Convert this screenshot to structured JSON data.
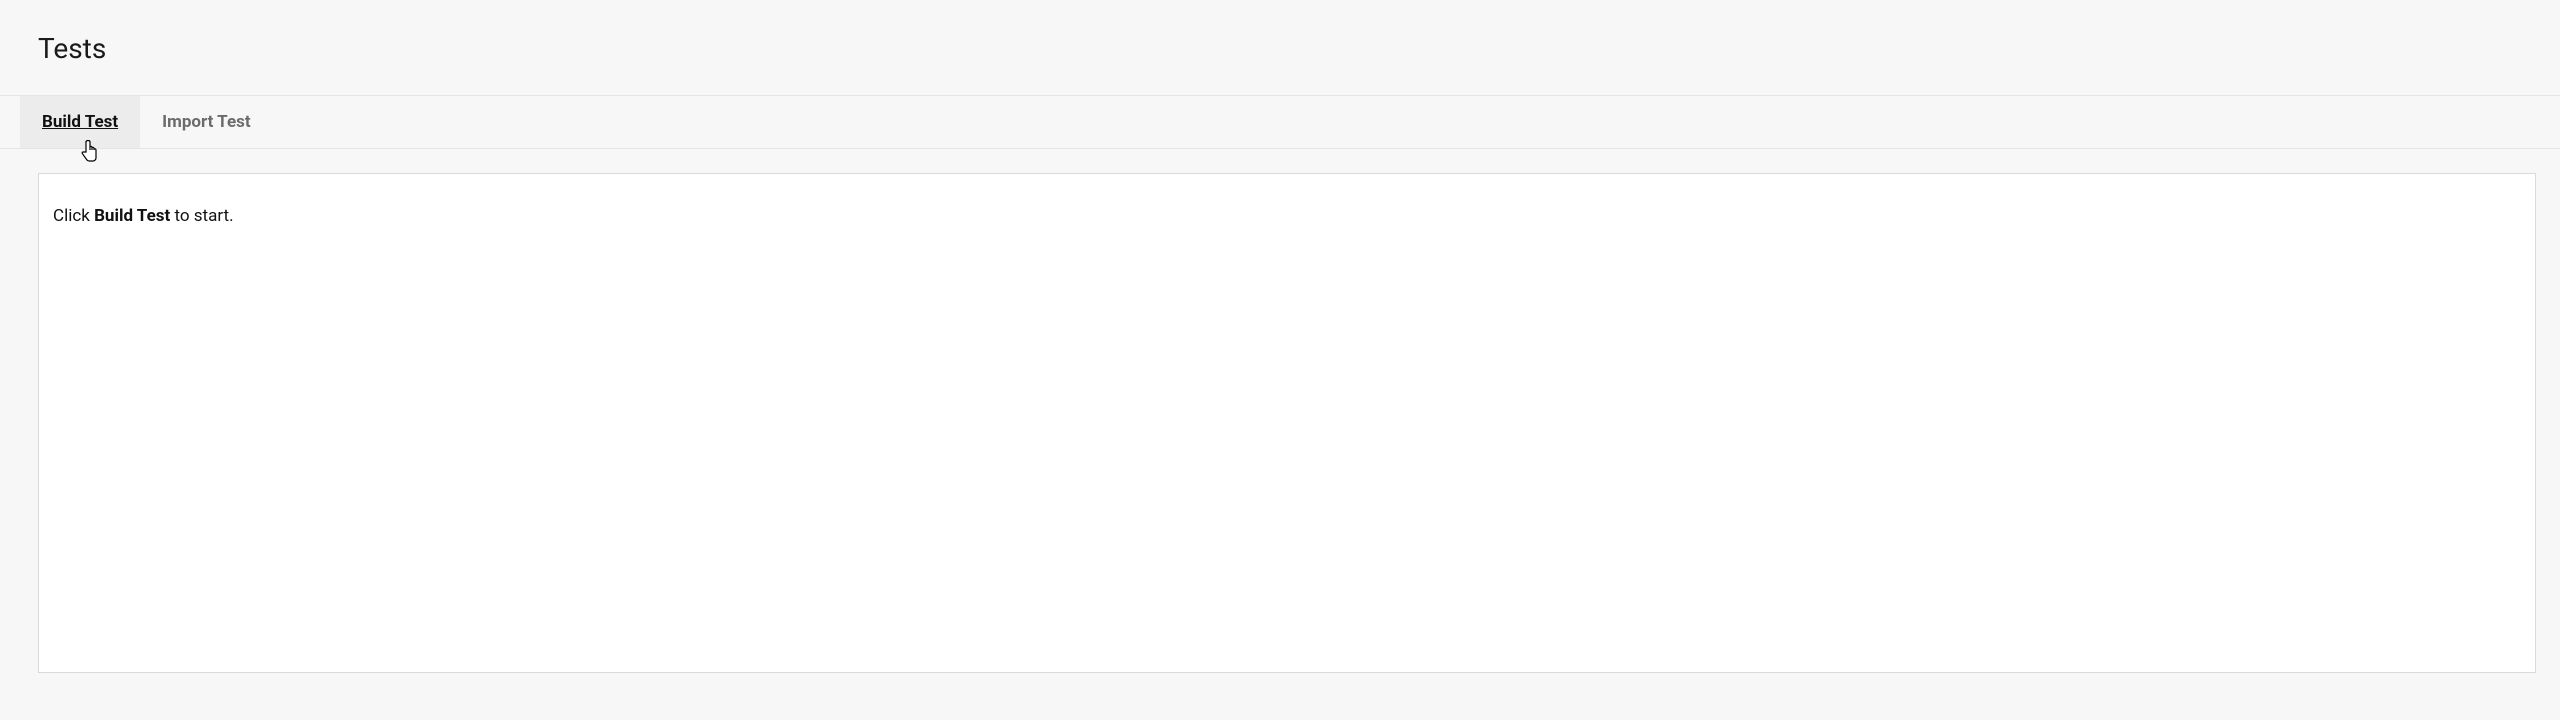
{
  "header": {
    "title": "Tests"
  },
  "tabs": {
    "build": {
      "label": "Build Test"
    },
    "import": {
      "label": "Import Test"
    }
  },
  "panel": {
    "instruction_prefix": "Click ",
    "instruction_bold": "Build Test",
    "instruction_suffix": " to start."
  }
}
